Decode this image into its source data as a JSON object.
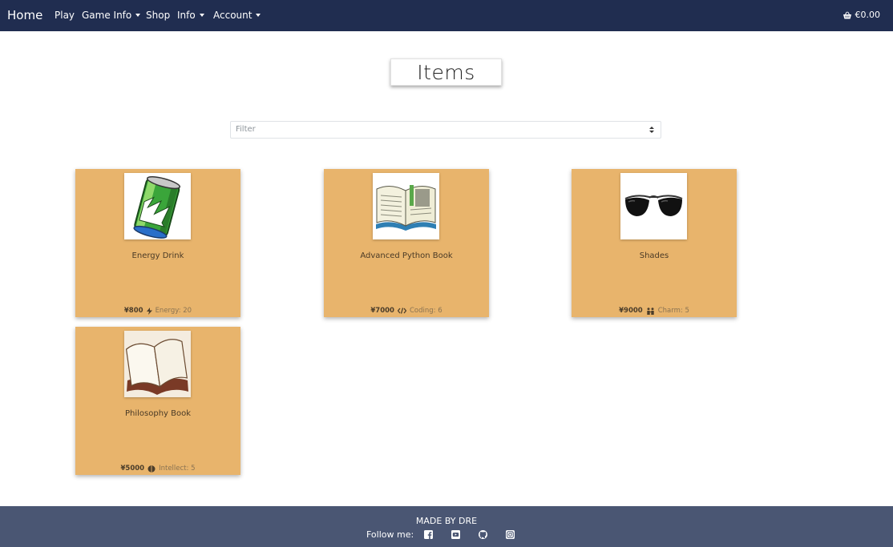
{
  "nav": {
    "brand": "Home",
    "links": [
      "Play",
      "Game Info",
      "Shop",
      "Info",
      "Account"
    ],
    "cart_total": "€0.00"
  },
  "page": {
    "title": "Items",
    "filter_placeholder": "Filter"
  },
  "items": [
    {
      "name": "Energy Drink",
      "price": "¥800",
      "stat": "Energy: 20",
      "stat_icon": "bolt-icon"
    },
    {
      "name": "Advanced Python Book",
      "price": "¥7000",
      "stat": "Coding: 6",
      "stat_icon": "code-icon"
    },
    {
      "name": "Shades",
      "price": "¥9000",
      "stat": "Charm: 5",
      "stat_icon": "people-icon"
    },
    {
      "name": "Philosophy Book",
      "price": "¥5000",
      "stat": "Intellect: 5",
      "stat_icon": "brain-icon"
    }
  ],
  "footer": {
    "made_by": "MADE BY DRE",
    "follow_label": "Follow me:",
    "socials": [
      "facebook-icon",
      "youtube-icon",
      "github-icon",
      "instagram-icon"
    ]
  },
  "colors": {
    "navbar": "#202d50",
    "card": "#e8b46c",
    "footer": "#4a5673"
  }
}
